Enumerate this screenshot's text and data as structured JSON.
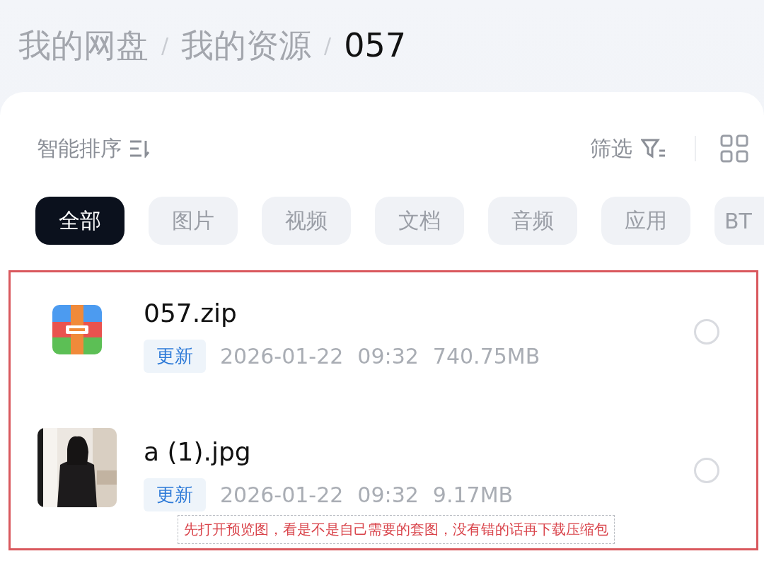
{
  "breadcrumb": [
    {
      "label": "我的网盘",
      "current": false
    },
    {
      "label": "我的资源",
      "current": false
    },
    {
      "label": "057",
      "current": true
    }
  ],
  "breadcrumb_separator": "/",
  "sort": {
    "label": "智能排序"
  },
  "filter": {
    "label": "筛选"
  },
  "chips": [
    {
      "label": "全部",
      "selected": true
    },
    {
      "label": "图片",
      "selected": false
    },
    {
      "label": "视频",
      "selected": false
    },
    {
      "label": "文档",
      "selected": false
    },
    {
      "label": "音频",
      "selected": false
    },
    {
      "label": "应用",
      "selected": false
    },
    {
      "label": "BT",
      "selected": false
    }
  ],
  "files": [
    {
      "kind": "zip",
      "name": "057.zip",
      "tag": "更新",
      "date": "2026-01-22",
      "time": "09:32",
      "size": "740.75MB",
      "selected": false
    },
    {
      "kind": "picture",
      "name": "a (1).jpg",
      "tag": "更新",
      "date": "2026-01-22",
      "time": "09:32",
      "size": "9.17MB",
      "selected": false
    }
  ],
  "annotation": "先打开预览图，看是不是自己需要的套图，没有错的话再下载压缩包"
}
